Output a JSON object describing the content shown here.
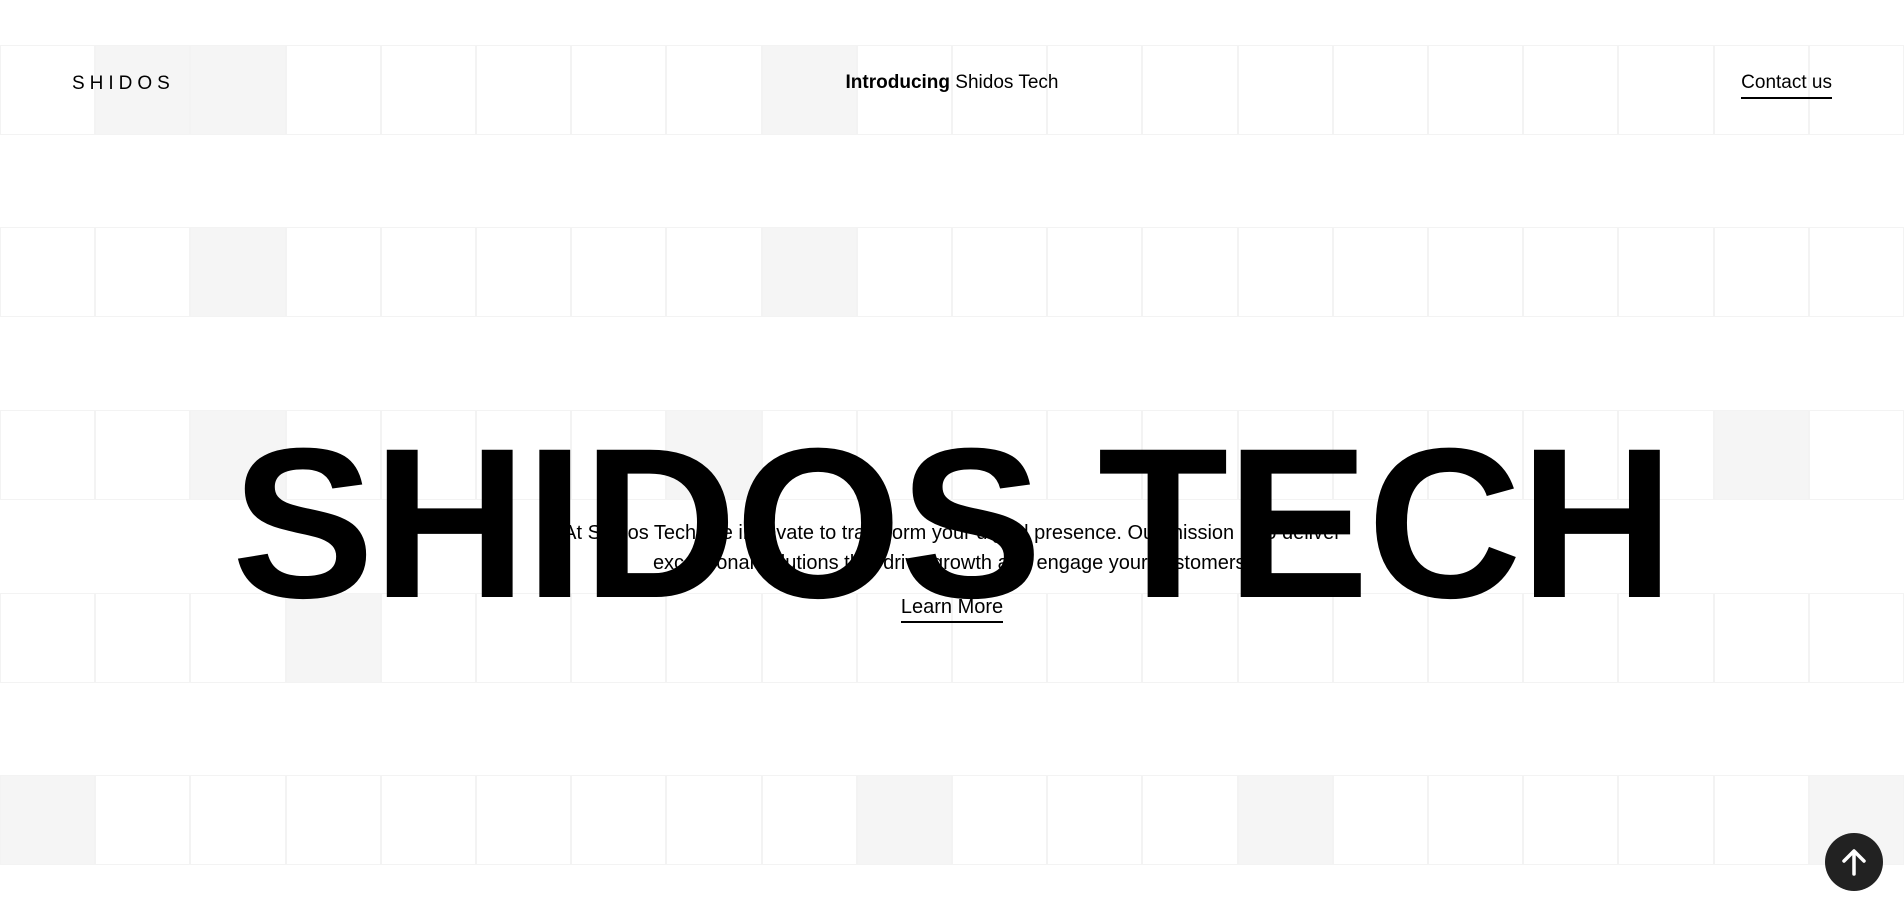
{
  "header": {
    "logo": "SHIDOS",
    "intro_bold": "Introducing",
    "intro_rest": " Shidos Tech",
    "contact_label": "Contact us"
  },
  "hero": {
    "title": "SHIDOS TECH",
    "description": "At Shidos Tech, we innovate to transform your digital presence. Our mission is to deliver exceptional solutions that drive growth and engage your customers.",
    "cta_label": "Learn More"
  },
  "scroll_top": {
    "icon": "arrow-up-icon"
  },
  "colors": {
    "background": "#ffffff",
    "text": "#000000",
    "grid_line": "#f3f3f3",
    "grid_shade": "#f5f5f5",
    "scroll_button": "#222222"
  }
}
